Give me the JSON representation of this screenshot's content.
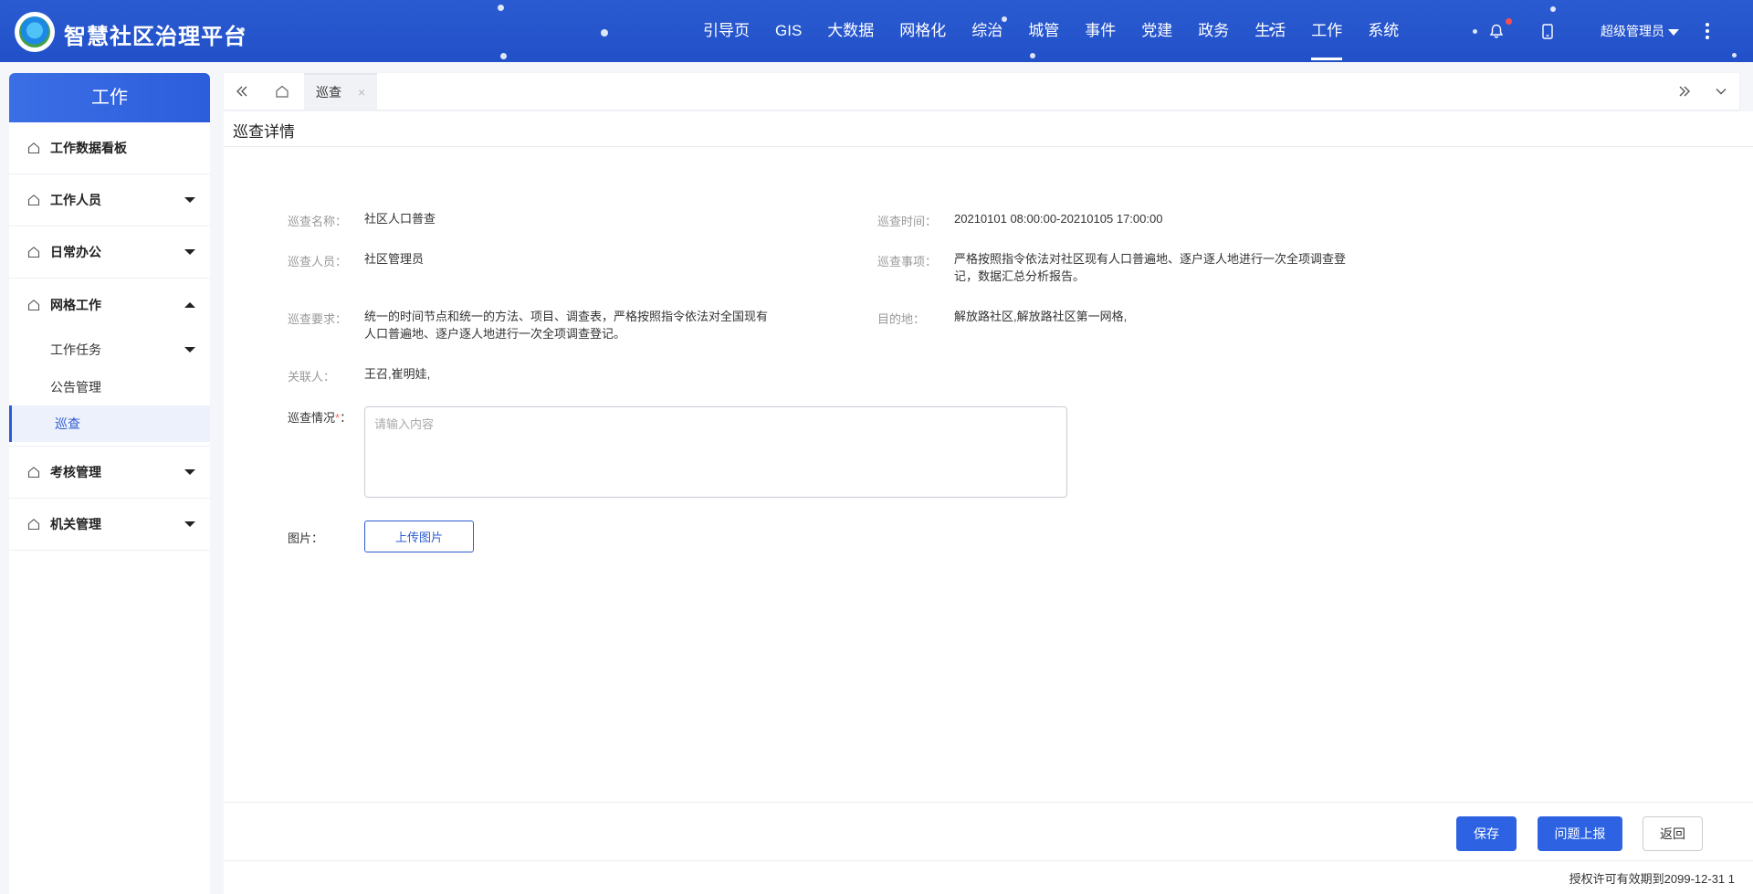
{
  "app": {
    "title": "智慧社区治理平台",
    "brand_color": "#2150c8"
  },
  "nav": {
    "items": [
      {
        "label": "引导页"
      },
      {
        "label": "GIS"
      },
      {
        "label": "大数据"
      },
      {
        "label": "网格化"
      },
      {
        "label": "综治"
      },
      {
        "label": "城管"
      },
      {
        "label": "事件"
      },
      {
        "label": "党建"
      },
      {
        "label": "政务"
      },
      {
        "label": "生活"
      },
      {
        "label": "工作"
      },
      {
        "label": "系统"
      }
    ],
    "active": "工作",
    "icons": [
      "bell-icon",
      "tablet-icon"
    ],
    "user": "超级管理员"
  },
  "sidebar": {
    "header": "工作",
    "items": [
      {
        "label": "工作数据看板"
      },
      {
        "label": "工作人员"
      },
      {
        "label": "日常办公"
      },
      {
        "label": "网格工作"
      },
      {
        "label": "考核管理"
      },
      {
        "label": "机关管理"
      }
    ],
    "sub_items": [
      {
        "label": "工作任务"
      },
      {
        "label": "公告管理"
      },
      {
        "label": "巡查"
      }
    ]
  },
  "tabbar": {
    "tab_label": "巡查",
    "close_glyph": "×"
  },
  "page": {
    "title": "巡查详情",
    "fields": {
      "name_label": "巡查名称：",
      "name_value": "社区人口普查",
      "time_label": "巡查时间：",
      "time_value": "20210101 08:00:00-20210105 17:00:00",
      "person_label": "巡查人员：",
      "person_value": "社区管理员",
      "matter_label": "巡查事项：",
      "matter_value_line1": "严格按照指令依法对社区现有人口普遍地、逐户逐人地进行一次全项调查登",
      "matter_value_line2": "记，数据汇总分析报告。",
      "req_label": "巡查要求：",
      "req_value_line1": "统一的时间节点和统一的方法、项目、调查表，严格按照指令依法对全国现有",
      "req_value_line2": "人口普遍地、逐户逐人地进行一次全项调查登记。",
      "dest_label": "目的地：",
      "dest_value": "解放路社区,解放路社区第一网格,",
      "contact_label": "关联人：",
      "contact_value": "王召,崔明娃,",
      "situation_label": "巡查情况",
      "situation_required": "*",
      "situation_colon": "：",
      "situation_placeholder": "请输入内容",
      "image_label": "图片：",
      "upload_label": "上传图片"
    },
    "buttons": {
      "save": "保存",
      "report": "问题上报",
      "back": "返回"
    },
    "license": "授权许可有效期到2099-12-31 1"
  }
}
